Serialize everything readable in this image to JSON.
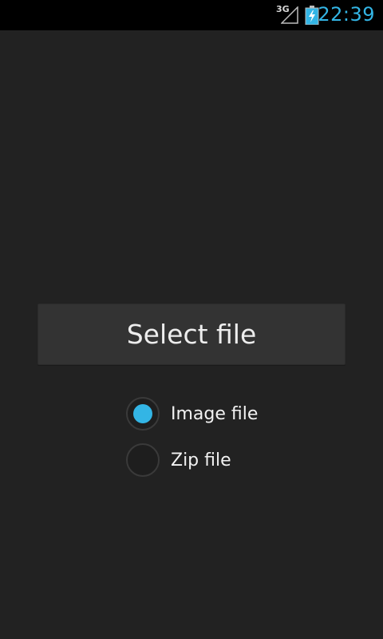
{
  "status_bar": {
    "network_type": "3G",
    "signal_icon": "signal-strength-icon",
    "battery_icon": "battery-charging-icon",
    "time": "22:39",
    "accent_color": "#33b5e5"
  },
  "main": {
    "select_button_label": "Select file",
    "options": [
      {
        "label": "Image file",
        "selected": true
      },
      {
        "label": "Zip file",
        "selected": false
      }
    ]
  },
  "colors": {
    "background": "#222222",
    "status_bar": "#000000",
    "button": "#333333",
    "radio_selected": "#33b5e5"
  }
}
